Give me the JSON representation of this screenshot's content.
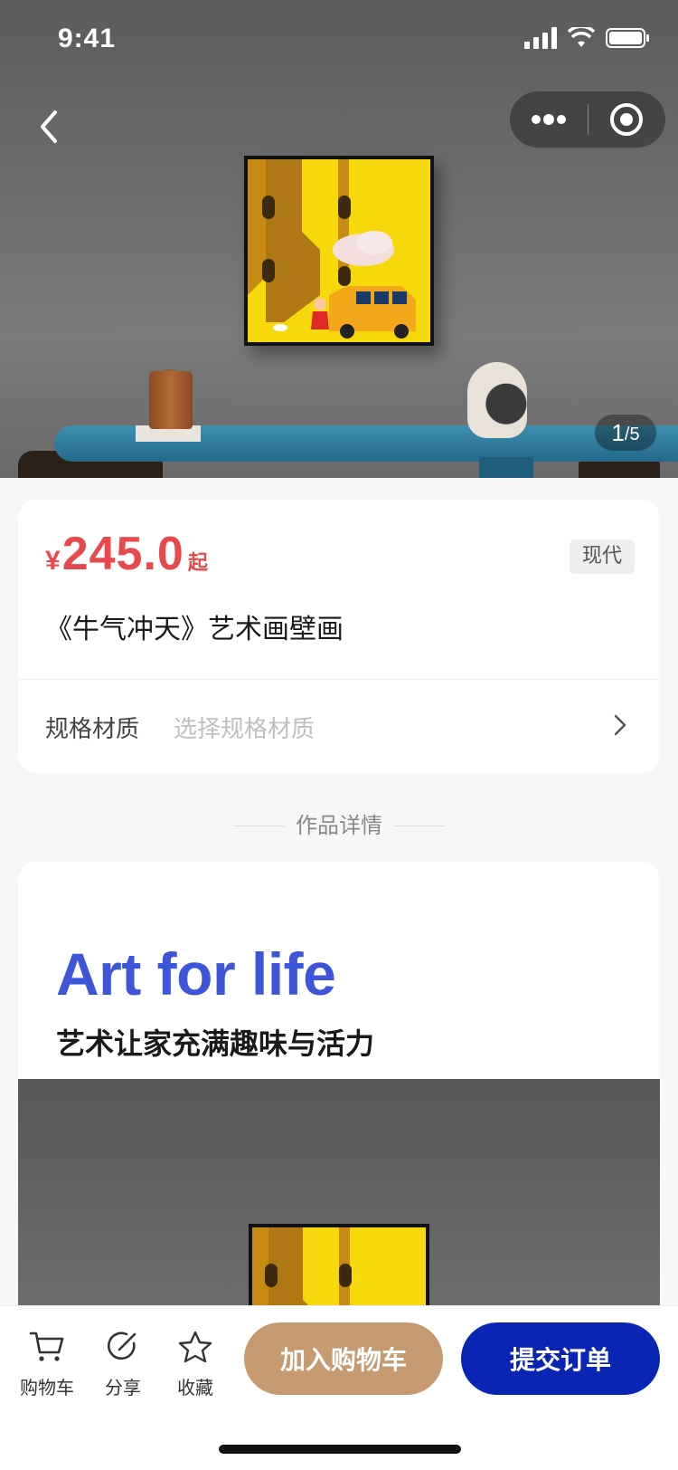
{
  "status_bar": {
    "time": "9:41"
  },
  "hero": {
    "pager_current": "1",
    "pager_total": "/5",
    "icons": [
      "back-icon",
      "more-icon",
      "target-icon"
    ]
  },
  "product": {
    "currency": "¥",
    "price": "245.0",
    "price_suffix": "起",
    "style_tag": "现代",
    "title": "《牛气冲天》艺术画壁画",
    "spec_label": "规格材质",
    "spec_placeholder": "选择规格材质"
  },
  "section": {
    "title": "作品详情"
  },
  "detail": {
    "headline_en": "Art for life",
    "headline_cn": "艺术让家充满趣味与活力"
  },
  "bottom_bar": {
    "tabs": [
      {
        "label": "购物车",
        "icon": "cart-icon"
      },
      {
        "label": "分享",
        "icon": "share-icon"
      },
      {
        "label": "收藏",
        "icon": "star-icon"
      }
    ],
    "add_to_cart": "加入购物车",
    "submit_order": "提交订单"
  },
  "colors": {
    "price": "#e84a4c",
    "add_to_cart_bg": "#c59a70",
    "submit_bg": "#0a24b4",
    "headline_en": "#3d55d8"
  }
}
